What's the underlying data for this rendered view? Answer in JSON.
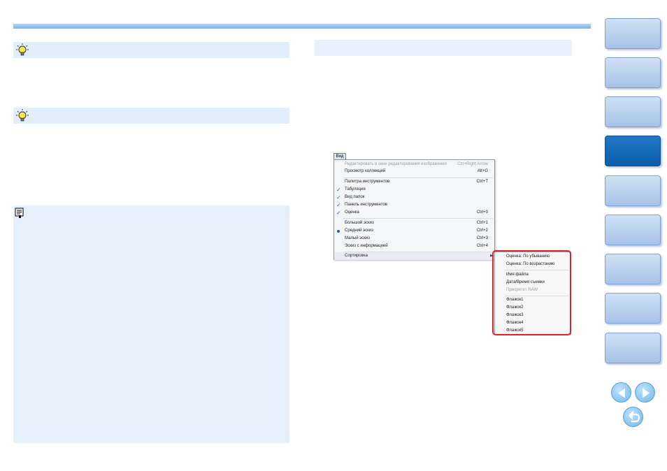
{
  "menu": {
    "tab_label": "Вид",
    "items": [
      {
        "label": "Редактировать в окне редактирования изображения",
        "shortcut": "Ctrl+Right Arrow",
        "state": "disabled"
      },
      {
        "label": "Просмотр коллекций",
        "shortcut": "Alt+G",
        "state": "normal"
      },
      {
        "label": "Палитра инструментов",
        "shortcut": "Ctrl+T",
        "state": "normal"
      },
      {
        "label": "Табуляция",
        "shortcut": "",
        "state": "checked"
      },
      {
        "label": "Вид папок",
        "shortcut": "",
        "state": "checked"
      },
      {
        "label": "Панель инструментов",
        "shortcut": "",
        "state": "checked"
      },
      {
        "label": "Оценка",
        "shortcut": "Ctrl+0",
        "state": "checked"
      },
      {
        "label": "Большой эскиз",
        "shortcut": "Ctrl+1",
        "state": "normal"
      },
      {
        "label": "Средний эскиз",
        "shortcut": "Ctrl+2",
        "state": "radio"
      },
      {
        "label": "Малый эскиз",
        "shortcut": "Ctrl+3",
        "state": "normal"
      },
      {
        "label": "Эскиз с информацией",
        "shortcut": "Ctrl+4",
        "state": "normal"
      },
      {
        "label": "Сортировка",
        "shortcut": "",
        "state": "submenu"
      }
    ]
  },
  "submenu": {
    "items": [
      {
        "label": "Оценка: По убыванию",
        "state": "normal"
      },
      {
        "label": "Оценка: По возрастанию",
        "state": "normal"
      },
      {
        "label": "Имя файла",
        "state": "normal"
      },
      {
        "label": "Дата/Время съемки",
        "state": "normal"
      },
      {
        "label": "Приоритет RAW",
        "state": "disabled"
      },
      {
        "label": "Флажок1",
        "state": "normal"
      },
      {
        "label": "Флажок2",
        "state": "normal"
      },
      {
        "label": "Флажок3",
        "state": "normal"
      },
      {
        "label": "Флажок4",
        "state": "normal"
      },
      {
        "label": "Флажок5",
        "state": "normal"
      }
    ]
  },
  "colors": {
    "accent_blue": "#0b5ea8",
    "highlight_red": "#e0222a",
    "tip_bar": "#e3eefb"
  },
  "nav": {
    "tab_count": 9,
    "active_tab_index": 3,
    "icons": [
      "arrow-left-icon",
      "arrow-right-icon",
      "return-icon"
    ]
  }
}
